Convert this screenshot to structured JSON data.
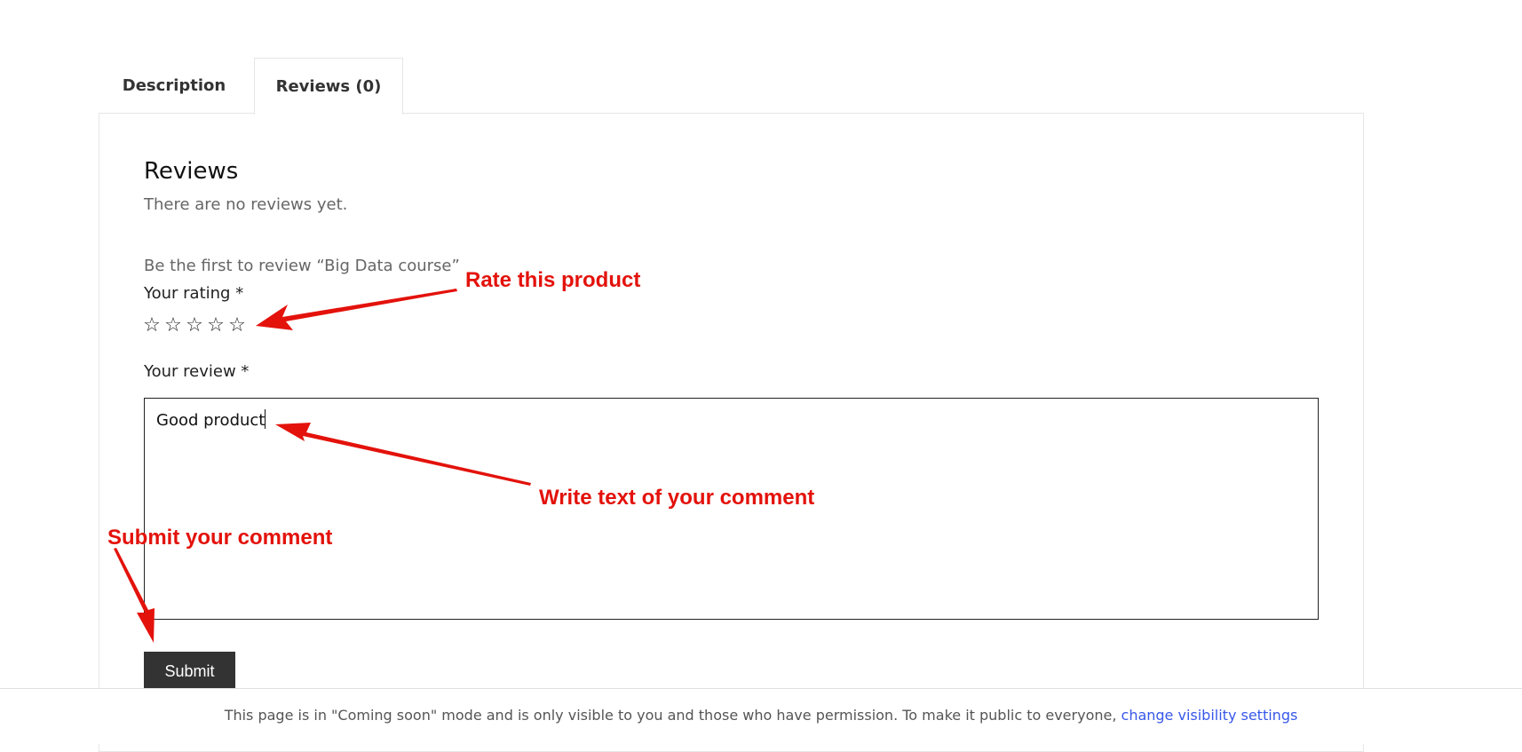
{
  "tabs": [
    {
      "label": "Description",
      "active": false
    },
    {
      "label": "Reviews (0)",
      "active": true
    }
  ],
  "reviews": {
    "title": "Reviews",
    "empty_text": "There are no reviews yet.",
    "be_first": "Be the first to review “Big Data course”",
    "rating_label": "Your rating *",
    "rating_value": 0,
    "rating_max": 5,
    "review_label": "Your review *",
    "review_value": "Good product",
    "submit_label": "Submit"
  },
  "notice": {
    "text": "This page is in \"Coming soon\" mode and is only visible to you and those who have permission. To make it public to everyone, ",
    "link": "change visibility settings"
  },
  "annotations": {
    "rate": "Rate this product",
    "write": "Write text of your comment",
    "submit": "Submit your comment",
    "color": "#e3120b"
  },
  "colors": {
    "button_bg": "#333333",
    "link": "#3858e9",
    "border": "#e6e6e6"
  }
}
